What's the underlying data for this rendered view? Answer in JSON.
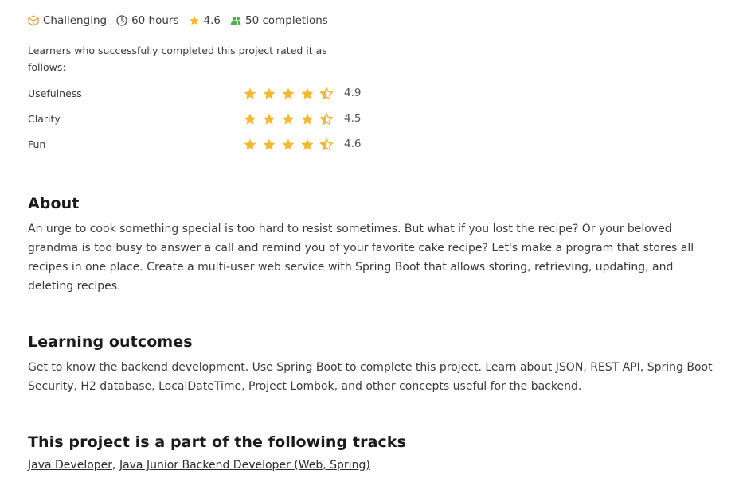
{
  "meta": {
    "difficulty": "Challenging",
    "duration": "60 hours",
    "rating": "4.6",
    "completions": "50 completions"
  },
  "ratings": {
    "intro": "Learners who successfully completed this project rated it as follows:",
    "items": [
      {
        "label": "Usefulness",
        "value": "4.9",
        "stars": 4.5
      },
      {
        "label": "Clarity",
        "value": "4.5",
        "stars": 4.5
      },
      {
        "label": "Fun",
        "value": "4.6",
        "stars": 4.5
      }
    ]
  },
  "about": {
    "title": "About",
    "text": "An urge to cook something special is too hard to resist sometimes. But what if you lost the recipe? Or your beloved grandma is too busy to answer a call and remind you of your favorite cake recipe? Let's make a program that stores all recipes in one place. Create a multi-user web service with Spring Boot that allows storing, retrieving, updating, and deleting recipes."
  },
  "outcomes": {
    "title": "Learning outcomes",
    "text": "Get to know the backend development. Use Spring Boot to complete this project. Learn about JSON, REST API, Spring Boot Security, H2 database, LocalDateTime, Project Lombok, and other concepts useful for the backend."
  },
  "tracks": {
    "title": "This project is a part of the following tracks",
    "links": [
      "Java Developer",
      "Java Junior Backend Developer (Web, Spring)"
    ],
    "separator": ", "
  },
  "colors": {
    "star": "#f5b82e",
    "difficulty_icon": "#e0a030",
    "completions_icon": "#4caf50"
  }
}
